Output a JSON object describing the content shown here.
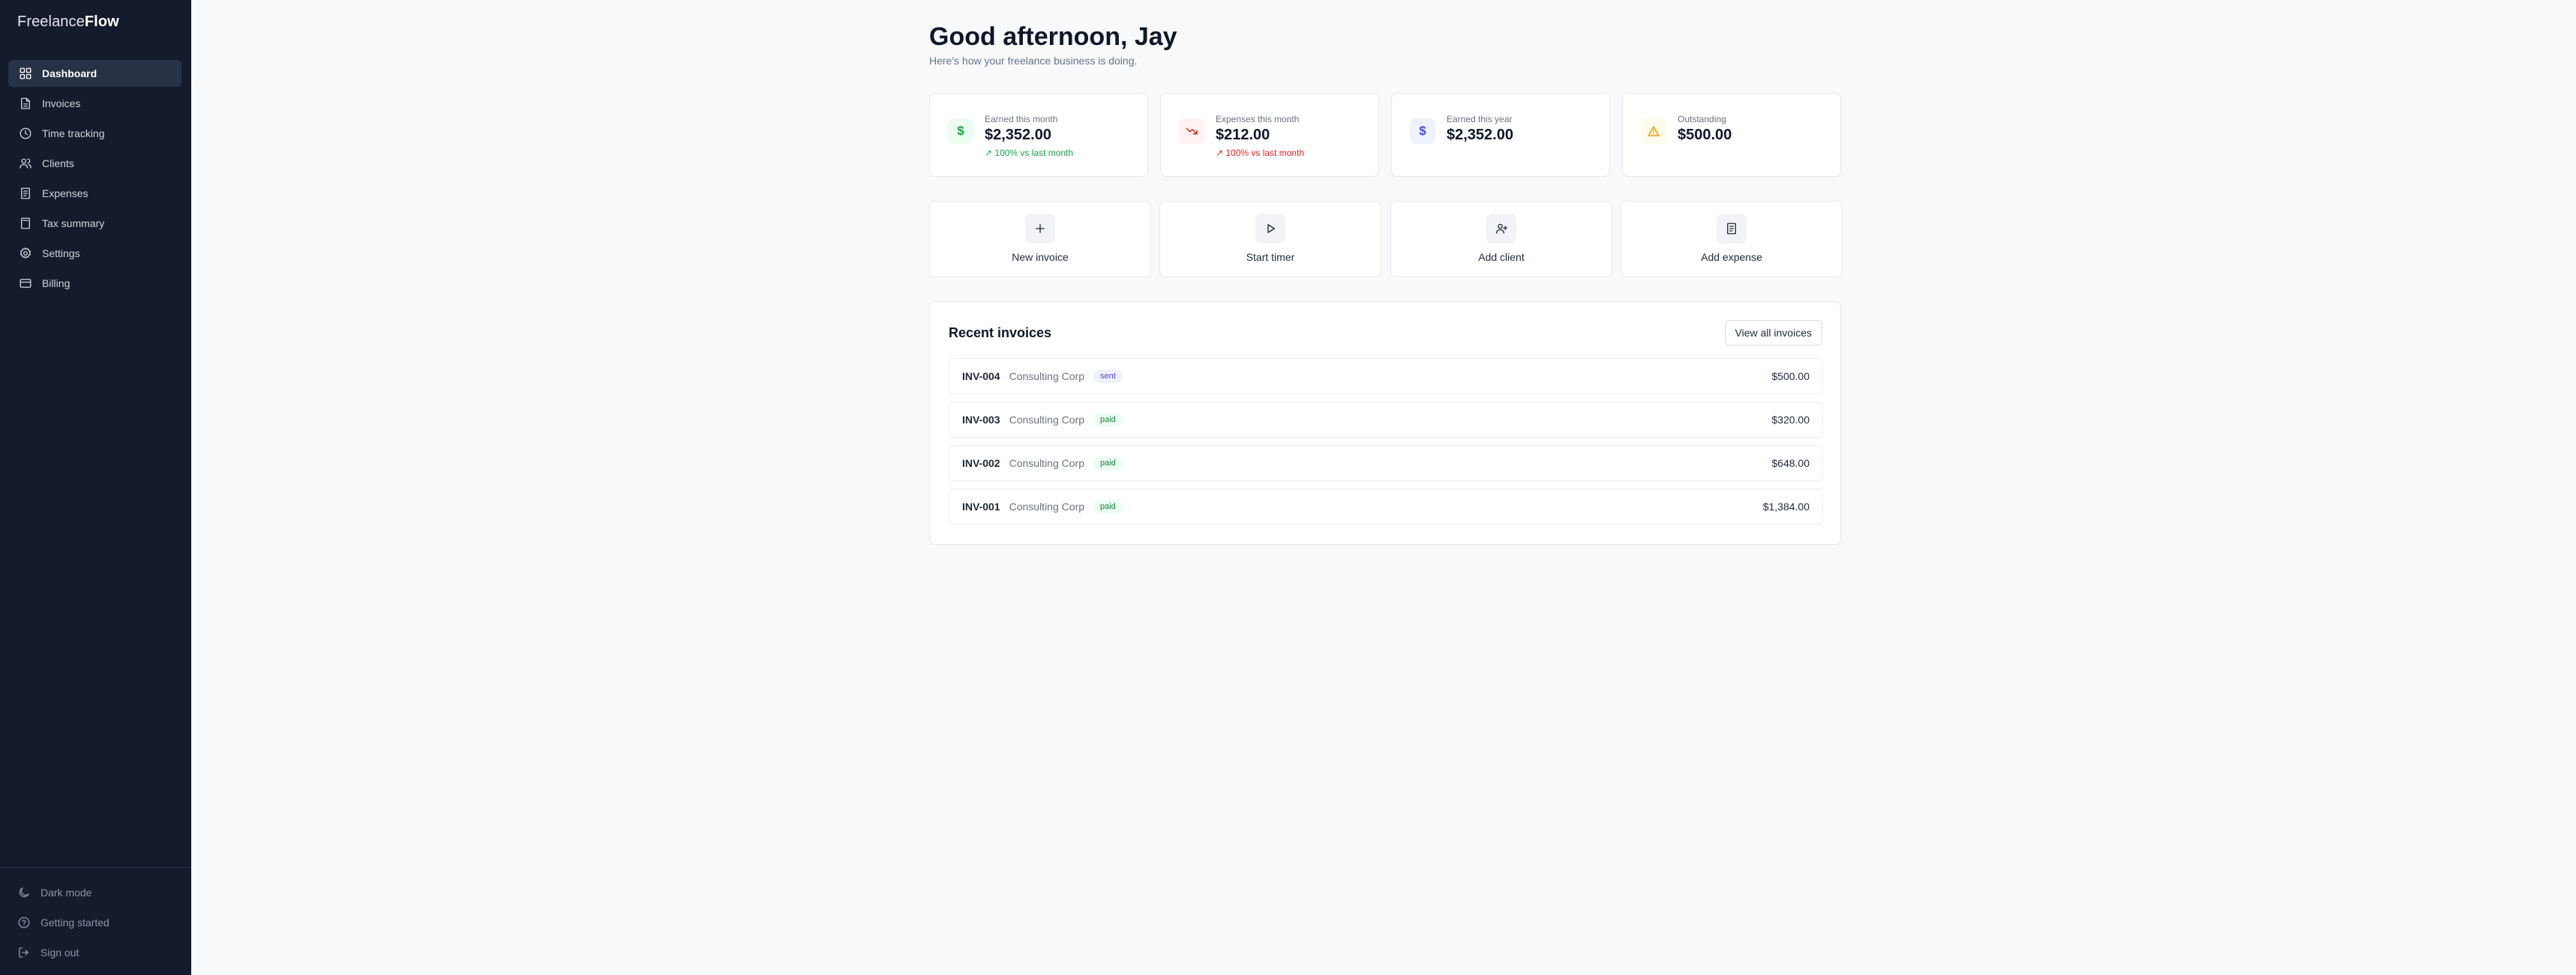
{
  "brand": {
    "prefix": "Freelance",
    "bold": "Flow"
  },
  "sidebar": {
    "items": [
      {
        "label": "Dashboard",
        "icon": "dashboard-icon",
        "active": true
      },
      {
        "label": "Invoices",
        "icon": "file-icon"
      },
      {
        "label": "Time tracking",
        "icon": "clock-icon"
      },
      {
        "label": "Clients",
        "icon": "users-icon"
      },
      {
        "label": "Expenses",
        "icon": "receipt-icon"
      },
      {
        "label": "Tax summary",
        "icon": "calculator-icon"
      },
      {
        "label": "Settings",
        "icon": "gear-icon"
      },
      {
        "label": "Billing",
        "icon": "credit-card-icon"
      }
    ],
    "bottom": [
      {
        "label": "Dark mode",
        "icon": "moon-icon"
      },
      {
        "label": "Getting started",
        "icon": "help-circle-icon"
      },
      {
        "label": "Sign out",
        "icon": "sign-out-icon"
      }
    ]
  },
  "header": {
    "greeting": "Good afternoon, Jay",
    "subtitle": "Here's how your freelance business is doing."
  },
  "stats": [
    {
      "label": "Earned this month",
      "value": "$2,352.00",
      "change": "↗ 100% vs last month",
      "icon": "dollar-icon",
      "accent": "#16a34a"
    },
    {
      "label": "Expenses this month",
      "value": "$212.00",
      "change": "↗ 100% vs last month",
      "icon": "trending-down-icon",
      "accent": "#dc2626"
    },
    {
      "label": "Earned this year",
      "value": "$2,352.00",
      "change": "",
      "icon": "dollar-icon",
      "accent": "#4f46e5"
    },
    {
      "label": "Outstanding",
      "value": "$500.00",
      "change": "",
      "icon": "alert-triangle-icon",
      "accent": "#f59e0b"
    }
  ],
  "actions": [
    {
      "label": "New invoice",
      "icon": "plus-icon"
    },
    {
      "label": "Start timer",
      "icon": "play-icon"
    },
    {
      "label": "Add client",
      "icon": "user-plus-icon"
    },
    {
      "label": "Add expense",
      "icon": "receipt-icon"
    }
  ],
  "recent": {
    "title": "Recent invoices",
    "view_all": "View all invoices",
    "rows": [
      {
        "id": "INV-004",
        "client": "Consulting Corp",
        "status": "sent",
        "amount": "$500.00"
      },
      {
        "id": "INV-003",
        "client": "Consulting Corp",
        "status": "paid",
        "amount": "$320.00"
      },
      {
        "id": "INV-002",
        "client": "Consulting Corp",
        "status": "paid",
        "amount": "$648.00"
      },
      {
        "id": "INV-001",
        "client": "Consulting Corp",
        "status": "paid",
        "amount": "$1,384.00"
      }
    ]
  }
}
